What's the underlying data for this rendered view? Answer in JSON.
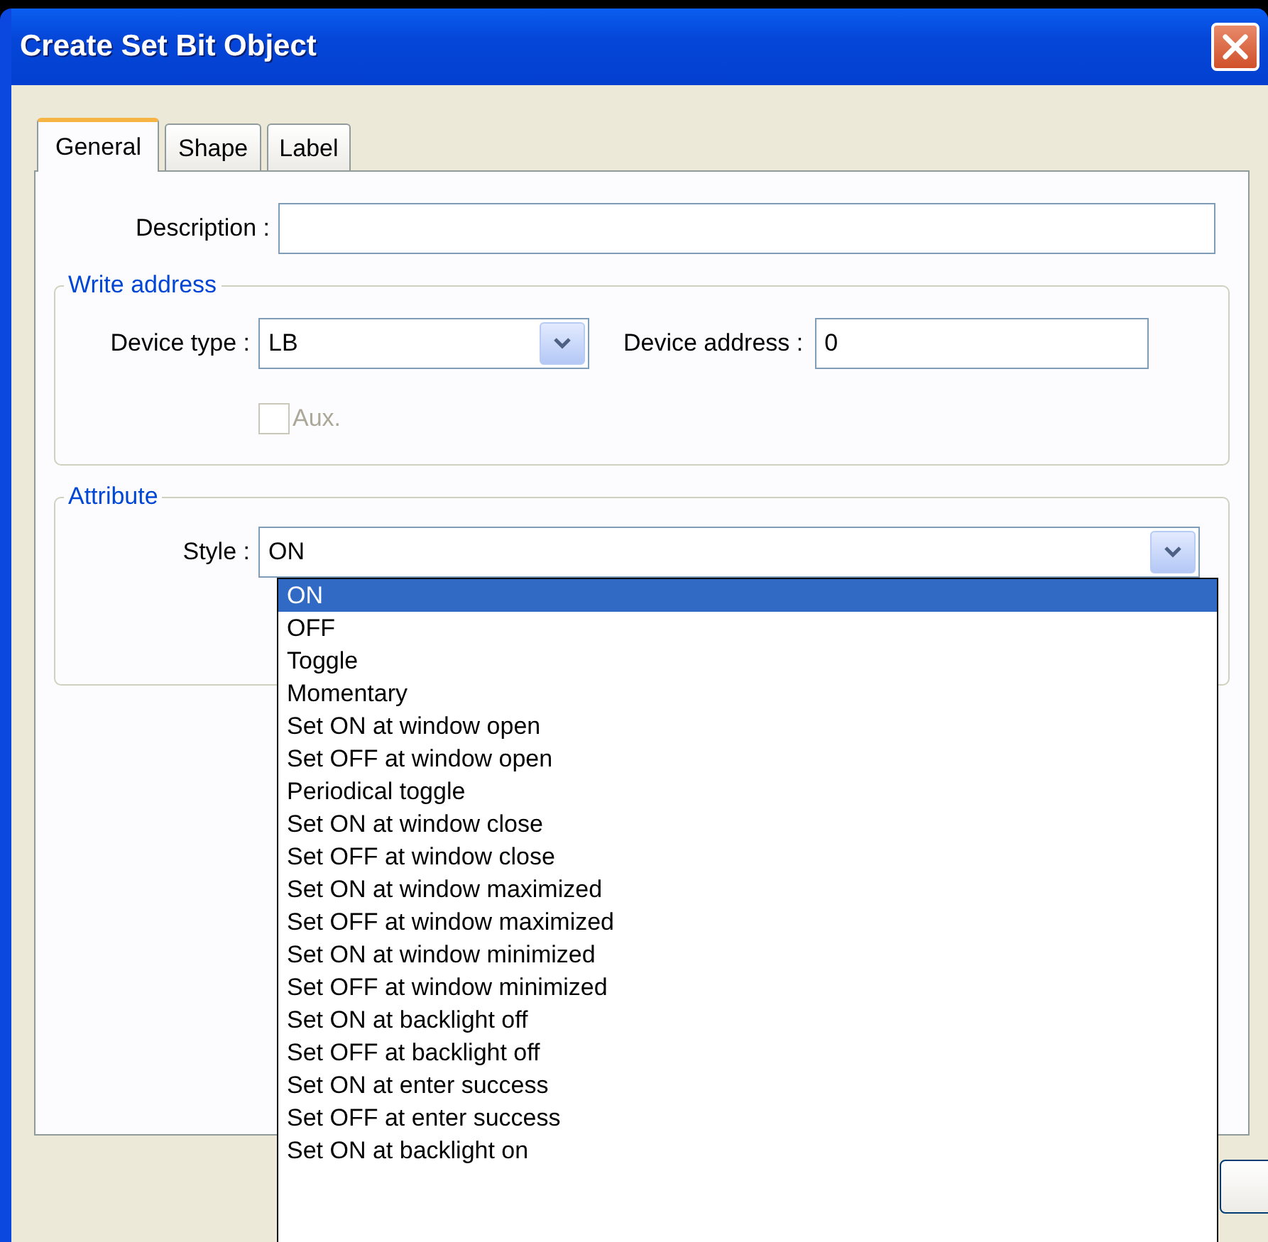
{
  "window": {
    "title": "Create Set Bit Object"
  },
  "tabs": [
    {
      "label": "General",
      "selected": true
    },
    {
      "label": "Shape",
      "selected": false
    },
    {
      "label": "Label",
      "selected": false
    }
  ],
  "description": {
    "label": "Description :"
  },
  "write_address": {
    "title": "Write address",
    "device_type": {
      "label": "Device type :",
      "value": "LB"
    },
    "device_address": {
      "label": "Device address :",
      "value": "0"
    },
    "aux": {
      "label": "Aux.",
      "checked": false,
      "disabled": true
    }
  },
  "attribute": {
    "title": "Attribute",
    "style": {
      "label": "Style :",
      "value": "ON",
      "expanded": true,
      "options": [
        {
          "label": "ON",
          "selected": true
        },
        {
          "label": "OFF",
          "selected": false
        },
        {
          "label": "Toggle",
          "selected": false
        },
        {
          "label": "Momentary",
          "selected": false
        },
        {
          "label": "Set ON at window open",
          "selected": false
        },
        {
          "label": "Set OFF at window open",
          "selected": false
        },
        {
          "label": "Periodical toggle",
          "selected": false
        },
        {
          "label": "Set ON at window close",
          "selected": false
        },
        {
          "label": "Set OFF at window close",
          "selected": false
        },
        {
          "label": "Set ON at window maximized",
          "selected": false
        },
        {
          "label": "Set OFF at window maximized",
          "selected": false
        },
        {
          "label": "Set ON at window minimized",
          "selected": false
        },
        {
          "label": "Set OFF at window minimized",
          "selected": false
        },
        {
          "label": "Set ON at backlight off",
          "selected": false
        },
        {
          "label": "Set OFF at backlight off",
          "selected": false
        },
        {
          "label": "Set ON at enter success",
          "selected": false
        },
        {
          "label": "Set OFF at enter success",
          "selected": false
        },
        {
          "label": "Set ON at backlight on",
          "selected": false
        }
      ]
    }
  }
}
